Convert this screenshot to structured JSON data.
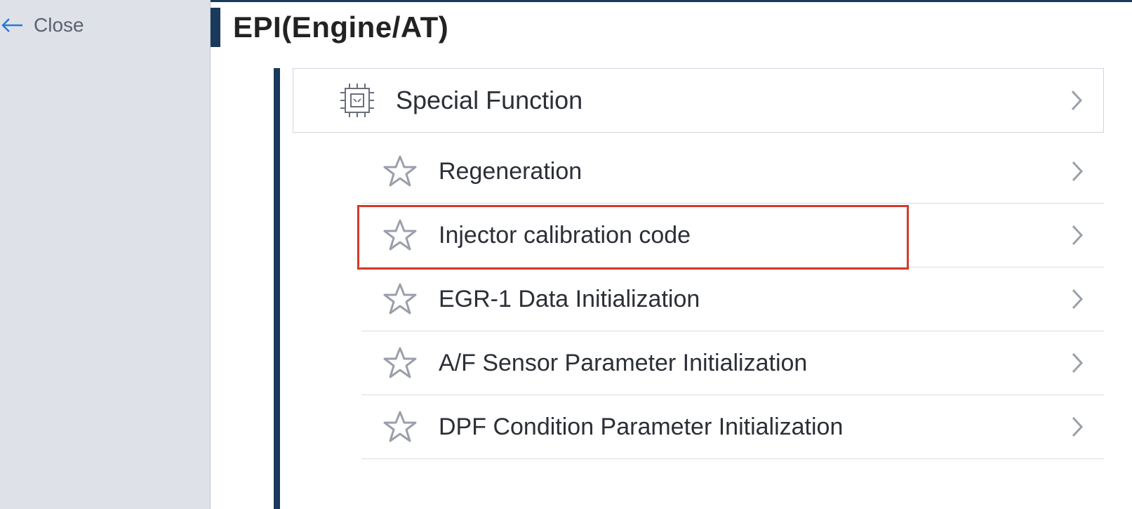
{
  "sidebar": {
    "close_label": "Close"
  },
  "header": {
    "title": "EPI(Engine/AT)"
  },
  "list": {
    "header": {
      "label": "Special Function"
    },
    "items": [
      {
        "label": "Regeneration",
        "highlighted": false
      },
      {
        "label": "Injector calibration code",
        "highlighted": true
      },
      {
        "label": "EGR-1 Data Initialization",
        "highlighted": false
      },
      {
        "label": "A/F Sensor Parameter Initialization",
        "highlighted": false
      },
      {
        "label": "DPF Condition Parameter Initialization",
        "highlighted": false
      }
    ]
  }
}
